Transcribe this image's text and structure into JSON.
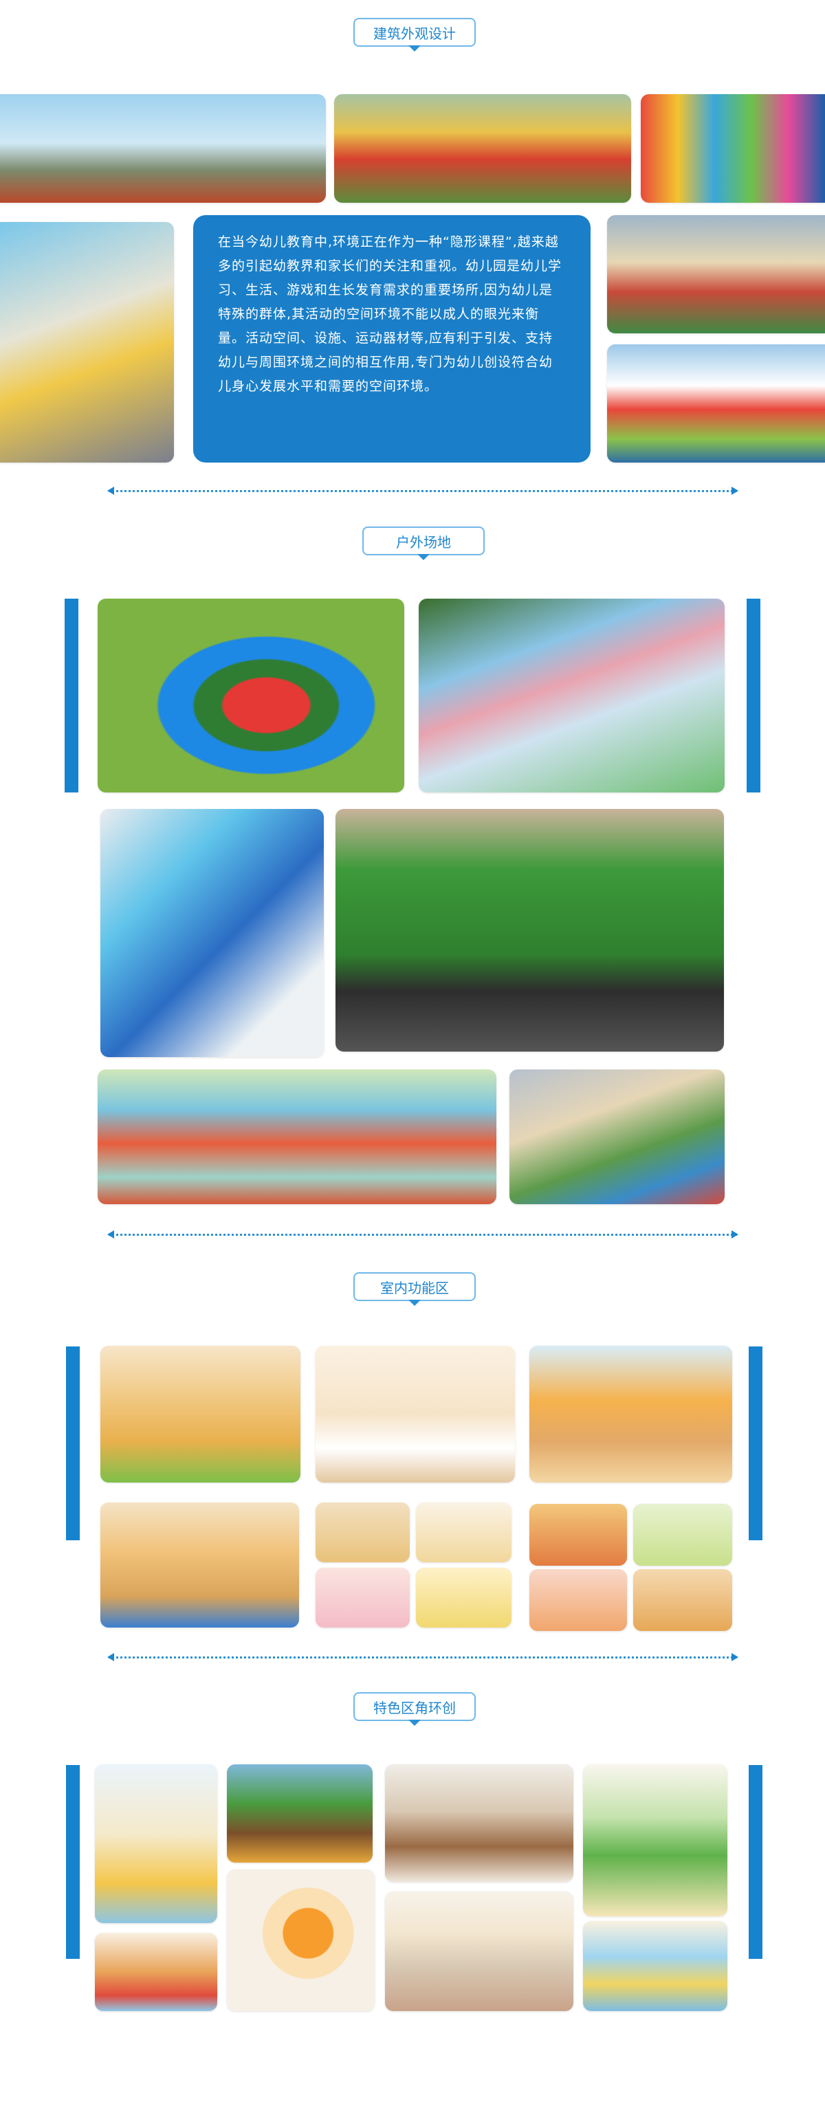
{
  "sections": {
    "architecture": {
      "title": "建筑外观设计"
    },
    "outdoor": {
      "title": "户外场地"
    },
    "indoor": {
      "title": "室内功能区"
    },
    "corners": {
      "title": "特色区角环创"
    }
  },
  "intro_text": "在当今幼儿教育中,环境正在作为一种“隐形课程”,越来越多的引起幼教界和家长们的关注和重视。幼儿园是幼儿学习、生活、游戏和生长发育需求的重要场所,因为幼儿是特殊的群体,其活动的空间环境不能以成人的眼光来衡量。活动空间、设施、运动器材等,应有利于引发、支持幼儿与周围环境之间的相互作用,专门为幼儿创设符合幼儿身心发展水平和需要的空间环境。",
  "colors": {
    "accent": "#1683cf",
    "text_box": "#1a7fc8",
    "pill_border": "#6fb8e8"
  }
}
